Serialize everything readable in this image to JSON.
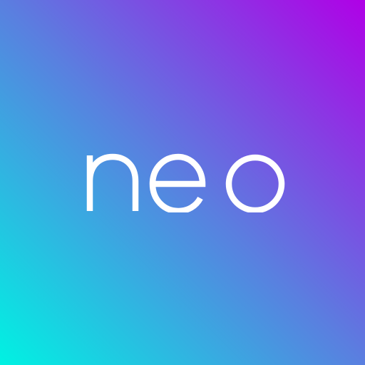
{
  "brand": {
    "wordmark": "neo"
  },
  "colors": {
    "gradient_top_right": "#b000e6",
    "gradient_middle": "#5a7fe0",
    "gradient_bottom_left": "#00f2e2",
    "wordmark": "#ffffff"
  }
}
